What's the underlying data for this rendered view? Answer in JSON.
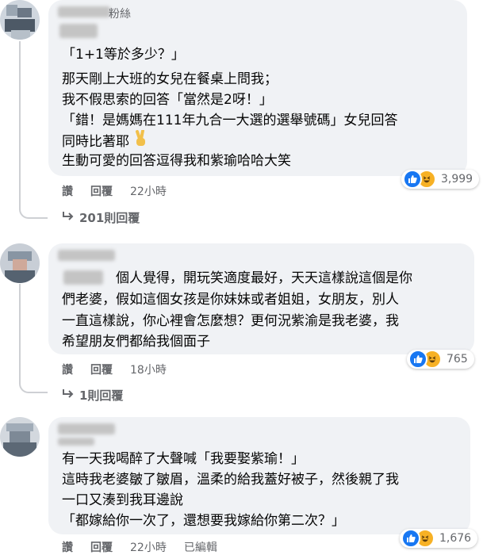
{
  "comments": [
    {
      "author_suffix": "粉絲",
      "lines": [
        "「1+1等於多少？」",
        "那天剛上大班的女兒在餐桌上問我；",
        "我不假思索的回答「當然是2呀！」",
        "「錯！是媽媽在111年九合一大選的選舉號碼」女兒回答",
        "同時比著耶",
        "生動可愛的回答逗得我和紫瑜哈哈大笑"
      ],
      "reaction_count": "3,999",
      "actions": {
        "like": "讚",
        "reply": "回覆",
        "time": "22小時"
      },
      "replies_label": "201則回覆"
    },
    {
      "lines": [
        "個人覺得，開玩笑適度最好，天天這樣說這個是你",
        "們老婆，假如這個女孩是你妹妹或者姐姐，女朋友，別人",
        "一直這樣說，你心裡會怎麼想？更何況紫渝是我老婆，我",
        "希望朋友們都給我個面子"
      ],
      "reaction_count": "765",
      "actions": {
        "like": "讚",
        "reply": "回覆",
        "time": "18小時"
      },
      "replies_label": "1則回覆"
    },
    {
      "lines": [
        "有一天我喝醉了大聲喊「我要娶紫瑜！」",
        "這時我老婆皺了皺眉，溫柔的給我蓋好被子，然後親了我",
        "一口又湊到我耳邊說",
        "「都嫁給你一次了，還想要我嫁給你第二次？」"
      ],
      "reaction_count": "1,676",
      "actions": {
        "like": "讚",
        "reply": "回覆",
        "time": "22小時",
        "edited": "已編輯"
      }
    }
  ],
  "icons": {
    "like": "thumbs-up-icon",
    "haha": "haha-icon",
    "reply_arrow": "reply-arrow-icon",
    "victory": "victory-hand-emoji"
  },
  "colors": {
    "bubble": "#f0f2f5",
    "like": "#1877f2",
    "haha": "#f7b125",
    "secondary_text": "#65676b"
  }
}
